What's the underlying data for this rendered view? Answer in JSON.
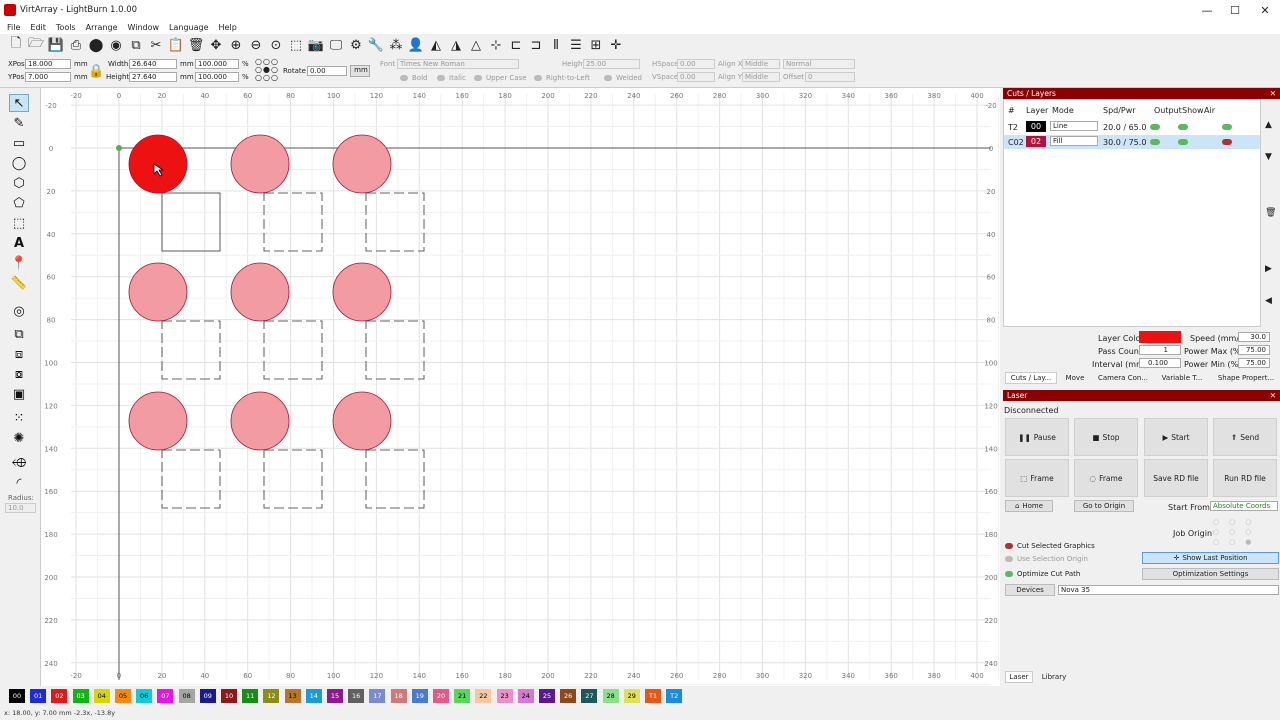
{
  "window": {
    "title": "VirtArray - LightBurn 1.0.00",
    "min": "—",
    "max": "☐",
    "close": "✕"
  },
  "menu": [
    "File",
    "Edit",
    "Tools",
    "Arrange",
    "Window",
    "Language",
    "Help"
  ],
  "props": {
    "xpos_label": "XPos",
    "xpos": "18.000",
    "ypos_label": "YPos",
    "ypos": "7.000",
    "mm": "mm",
    "width_label": "Width",
    "width": "26.640",
    "height_label": "Height",
    "height": "27.640",
    "scale_w": "100.000",
    "scale_h": "100.000",
    "pct": "%",
    "rotate_label": "Rotate",
    "rotate": "0.00",
    "unit_btn": "mm",
    "font_label": "Font",
    "font": "Times New Roman",
    "text_height_label": "Height",
    "text_height": "25.00",
    "hspace_label": "HSpace",
    "hspace": "0.00",
    "vspace_label": "VSpace",
    "vspace": "0.00",
    "alignx_label": "Align X",
    "alignx": "Middle",
    "aligny_label": "Align Y",
    "aligny": "Middle",
    "normal": "Normal",
    "offset_label": "Offset",
    "offset": "0",
    "bold": "Bold",
    "italic": "Italic",
    "upper": "Upper Case",
    "rtl": "Right-to-Left",
    "welded": "Welded"
  },
  "left_radius_label": "Radius:",
  "left_radius": "10.0",
  "ruler": {
    "x_ticks": [
      "-20",
      "0",
      "20",
      "40",
      "60",
      "80",
      "100",
      "120",
      "140",
      "160",
      "180",
      "200",
      "220",
      "240",
      "260",
      "280",
      "300",
      "320",
      "340",
      "360",
      "380",
      "400"
    ],
    "y_ticks": [
      "-20",
      "0",
      "20",
      "40",
      "60",
      "80",
      "100",
      "120",
      "140",
      "160",
      "180",
      "200",
      "220",
      "240"
    ]
  },
  "cuts": {
    "title": "Cuts / Layers",
    "headers": [
      "#",
      "Layer",
      "Mode",
      "Spd/Pwr",
      "Output",
      "Show",
      "Air"
    ],
    "rows": [
      {
        "id": "T2",
        "layer": "00",
        "mode": "Line",
        "spd": "20.0 / 65.0",
        "color": "#000000"
      },
      {
        "id": "C02",
        "layer": "02",
        "mode": "Fill",
        "spd": "30.0 / 75.0",
        "color": "#b0143c"
      }
    ],
    "layer_color_label": "Layer Color",
    "layer_color": "#ee1111",
    "pass_count_label": "Pass Count",
    "pass_count": "1",
    "interval_label": "Interval (mm)",
    "interval": "0.100",
    "speed_label": "Speed (mm/s)",
    "speed": "30.0",
    "pmax_label": "Power Max (%)",
    "pmax": "75.00",
    "pmin_label": "Power Min (%)",
    "pmin": "75.00",
    "tabs": [
      "Cuts / Lay...",
      "Move",
      "Camera Con...",
      "Variable T...",
      "Shape Propert..."
    ]
  },
  "laser": {
    "title": "Laser",
    "status": "Disconnected",
    "buttons": [
      "Pause",
      "Stop",
      "Start",
      "Send",
      "Frame",
      "Frame",
      "Save RD file",
      "Run RD file"
    ],
    "home": "Home",
    "goto_origin": "Go to Origin",
    "start_from_label": "Start From:",
    "start_from": "Absolute Coords",
    "job_origin_label": "Job Origin",
    "cut_selected": "Cut Selected Graphics",
    "use_selection": "Use Selection Origin",
    "optimize_path": "Optimize Cut Path",
    "show_last": "Show Last Position",
    "opt_settings": "Optimization Settings",
    "devices_btn": "Devices",
    "device": "Nova 35",
    "bottom_tabs": [
      "Laser",
      "Library"
    ]
  },
  "palette": [
    {
      "l": "00",
      "c": "#000000",
      "t": "#fff"
    },
    {
      "l": "01",
      "c": "#1f2bd6",
      "t": "#fff"
    },
    {
      "l": "02",
      "c": "#e01a1a",
      "t": "#fff"
    },
    {
      "l": "03",
      "c": "#16b316",
      "t": "#fff"
    },
    {
      "l": "04",
      "c": "#d6d600",
      "t": "#000"
    },
    {
      "l": "05",
      "c": "#f58a12",
      "t": "#000"
    },
    {
      "l": "06",
      "c": "#14c9d6",
      "t": "#000"
    },
    {
      "l": "07",
      "c": "#e614e6",
      "t": "#fff"
    },
    {
      "l": "08",
      "c": "#a5a5a5",
      "t": "#000"
    },
    {
      "l": "09",
      "c": "#1a1a8c",
      "t": "#fff"
    },
    {
      "l": "10",
      "c": "#8c1a1a",
      "t": "#fff"
    },
    {
      "l": "11",
      "c": "#1a8c1a",
      "t": "#fff"
    },
    {
      "l": "12",
      "c": "#8c8c1a",
      "t": "#fff"
    },
    {
      "l": "13",
      "c": "#b8752a",
      "t": "#000"
    },
    {
      "l": "14",
      "c": "#1a9bd6",
      "t": "#fff"
    },
    {
      "l": "15",
      "c": "#8c1a8c",
      "t": "#fff"
    },
    {
      "l": "16",
      "c": "#606060",
      "t": "#fff"
    },
    {
      "l": "17",
      "c": "#7a8ccc",
      "t": "#fff"
    },
    {
      "l": "18",
      "c": "#cc7a7a",
      "t": "#fff"
    },
    {
      "l": "19",
      "c": "#4a7acc",
      "t": "#fff"
    },
    {
      "l": "20",
      "c": "#e05a8c",
      "t": "#fff"
    },
    {
      "l": "21",
      "c": "#5ad65a",
      "t": "#000"
    },
    {
      "l": "22",
      "c": "#f5c8a0",
      "t": "#000"
    },
    {
      "l": "23",
      "c": "#e890c8",
      "t": "#000"
    },
    {
      "l": "24",
      "c": "#d678d6",
      "t": "#000"
    },
    {
      "l": "25",
      "c": "#5a1a8c",
      "t": "#fff"
    },
    {
      "l": "26",
      "c": "#8c4a1a",
      "t": "#fff"
    },
    {
      "l": "27",
      "c": "#1a5a5a",
      "t": "#fff"
    },
    {
      "l": "28",
      "c": "#8ce08c",
      "t": "#000"
    },
    {
      "l": "29",
      "c": "#e0e05a",
      "t": "#000"
    },
    {
      "l": "T1",
      "c": "#e05a1a",
      "t": "#fff"
    },
    {
      "l": "T2",
      "c": "#1a8ce0",
      "t": "#fff"
    }
  ],
  "status_text": "x: 18.00, y: 7.00 mm  -2.3x, -13.8y"
}
